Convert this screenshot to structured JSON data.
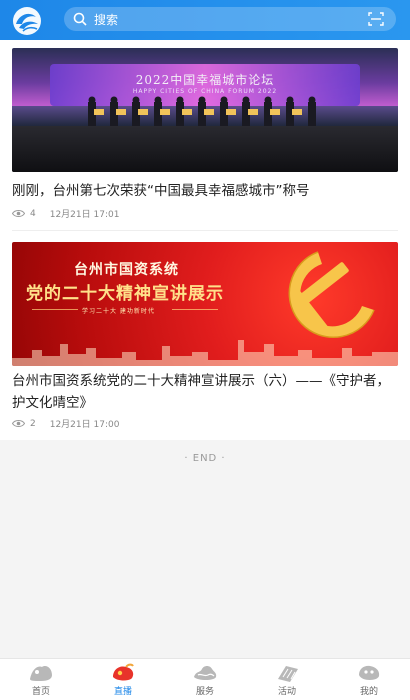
{
  "header": {
    "logo_icon": "wave-logo-icon",
    "search_placeholder": "搜索",
    "search_icon": "search-icon",
    "scan_icon": "scan-icon",
    "accent_color": "#1e87e8"
  },
  "articles": [
    {
      "image": {
        "banner_title": "2022中国幸福城市论坛",
        "banner_subtitle": "HAPPY CITIES OF CHINA FORUM 2022"
      },
      "title": "刚刚，台州第七次荣获“中国最具幸福感城市”称号",
      "views": "4",
      "time": "12月21日 17:01"
    },
    {
      "image": {
        "line1": "台州市国资系统",
        "line2": "党的二十大精神宣讲展示",
        "tagline": "学习二十大 建功新时代"
      },
      "title": "台州市国资系统党的二十大精神宣讲展示（六）——《守护者，护文化晴空》",
      "views": "2",
      "time": "12月21日 17:00"
    }
  ],
  "end_label": "· END ·",
  "tabs": [
    {
      "label": "首页",
      "icon": "home-icon",
      "active": false
    },
    {
      "label": "直播",
      "icon": "live-icon",
      "active": true
    },
    {
      "label": "服务",
      "icon": "service-icon",
      "active": false
    },
    {
      "label": "活动",
      "icon": "activity-icon",
      "active": false
    },
    {
      "label": "我的",
      "icon": "profile-icon",
      "active": false
    }
  ]
}
